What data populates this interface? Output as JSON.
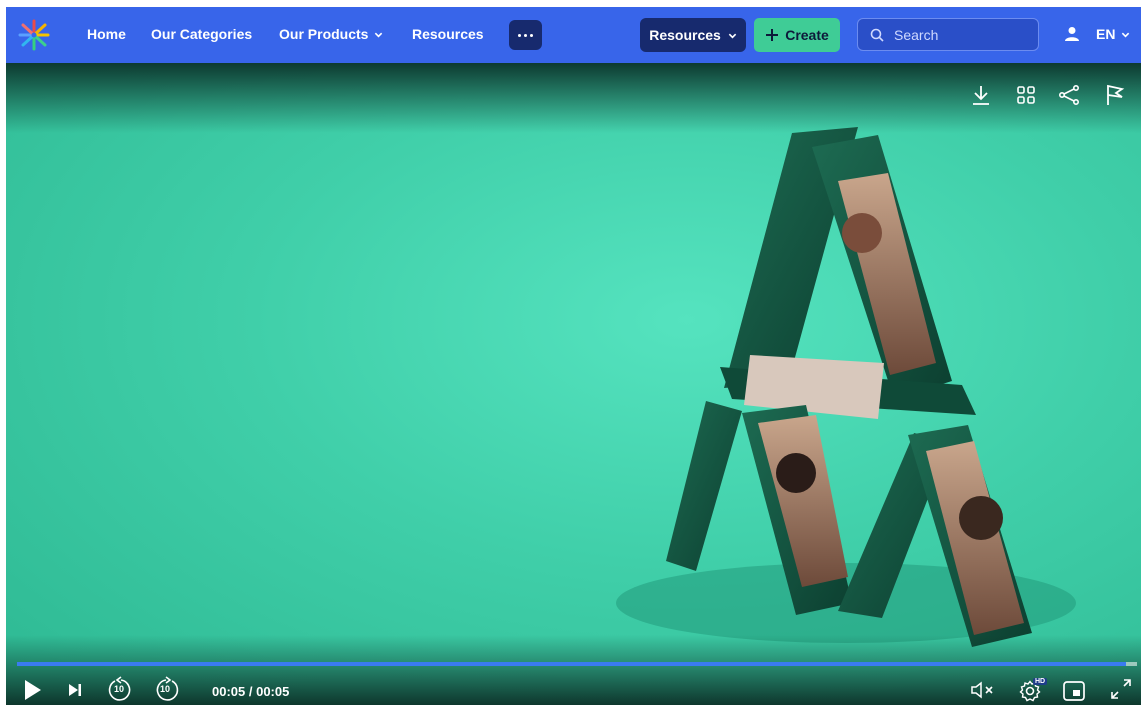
{
  "navbar": {
    "logo": "asterisk-logo",
    "links": [
      {
        "label": "Home",
        "has_dropdown": false
      },
      {
        "label": "Our Categories",
        "has_dropdown": false
      },
      {
        "label": "Our Products",
        "has_dropdown": true
      },
      {
        "label": "Resources",
        "has_dropdown": false
      }
    ],
    "more_icon": "ellipsis-icon",
    "resources_dropdown": "Resources",
    "create_label": "Create",
    "search_placeholder": "Search",
    "language": "EN",
    "colors": {
      "bar": "#3865ea",
      "dark": "#172a6e",
      "create": "#3fcc96"
    }
  },
  "video": {
    "top_actions": [
      "download-icon",
      "grid-icon",
      "share-icon",
      "flag-icon"
    ],
    "progress": 0.99,
    "time": "00:05 / 00:05",
    "controls": [
      "play-icon",
      "next-icon",
      "rewind-10-icon",
      "forward-10-icon",
      "mute-icon",
      "settings-icon",
      "pip-icon",
      "fullscreen-icon"
    ],
    "rewind_label": "10",
    "forward_label": "10",
    "quality_badge": "HD"
  }
}
